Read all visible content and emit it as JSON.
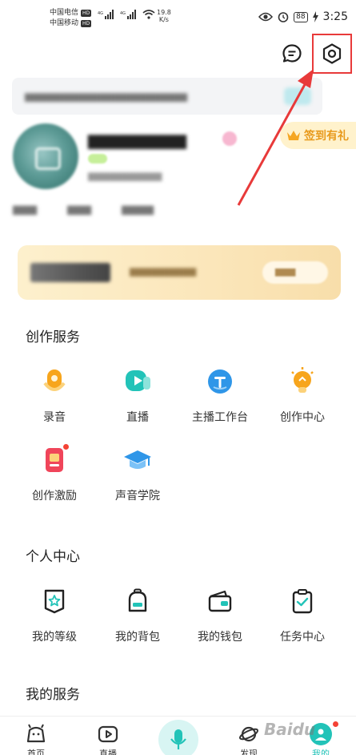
{
  "status_bar": {
    "carrier1": "中国电信",
    "carrier2": "中国移动",
    "hd_label": "HD",
    "net1": "4G",
    "net2": "4G",
    "speed_value": "19.8",
    "speed_unit": "K/s",
    "battery": "88",
    "time": "3:25"
  },
  "profile": {
    "signin_label": "签到有礼"
  },
  "sections": {
    "creation": {
      "title": "创作服务",
      "items": [
        {
          "label": "录音",
          "icon": "microphone-icon",
          "color": "#f7a51c"
        },
        {
          "label": "直播",
          "icon": "live-icon",
          "color": "#22c3b8"
        },
        {
          "label": "主播工作台",
          "icon": "workbench-icon",
          "color": "#2f96e8"
        },
        {
          "label": "创作中心",
          "icon": "lightbulb-icon",
          "color": "#f7a51c"
        },
        {
          "label": "创作激励",
          "icon": "reward-icon",
          "color": "#f0455a"
        },
        {
          "label": "声音学院",
          "icon": "graduation-cap-icon",
          "color": "#2f96e8"
        }
      ]
    },
    "personal": {
      "title": "个人中心",
      "items": [
        {
          "label": "我的等级",
          "icon": "level-icon"
        },
        {
          "label": "我的背包",
          "icon": "backpack-icon"
        },
        {
          "label": "我的钱包",
          "icon": "wallet-icon"
        },
        {
          "label": "任务中心",
          "icon": "task-icon"
        }
      ]
    },
    "services": {
      "title": "我的服务"
    }
  },
  "bottom_nav": [
    {
      "label": "首页",
      "icon": "home-icon"
    },
    {
      "label": "直播",
      "icon": "live-play-icon"
    },
    {
      "label": "",
      "icon": "mic-icon"
    },
    {
      "label": "发现",
      "icon": "planet-icon"
    },
    {
      "label": "我的",
      "icon": "profile-icon"
    }
  ],
  "watermark": "Baidu"
}
